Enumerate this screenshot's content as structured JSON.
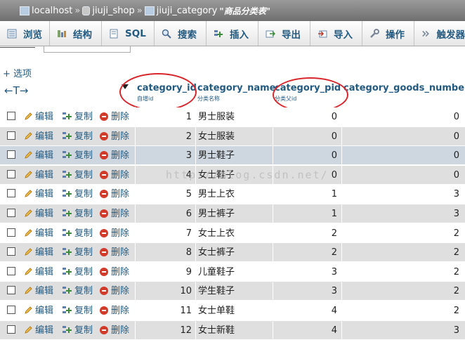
{
  "breadcrumb": {
    "server": "localhost",
    "database": "jiuji_shop",
    "table": "jiuji_category",
    "comment": "\"商品分类表\""
  },
  "tabs": [
    {
      "label": "浏览",
      "icon": "browse-icon"
    },
    {
      "label": "结构",
      "icon": "structure-icon"
    },
    {
      "label": "SQL",
      "icon": "sql-icon"
    },
    {
      "label": "搜索",
      "icon": "search-icon"
    },
    {
      "label": "插入",
      "icon": "insert-icon"
    },
    {
      "label": "导出",
      "icon": "export-icon"
    },
    {
      "label": "导入",
      "icon": "import-icon"
    },
    {
      "label": "操作",
      "icon": "wrench-icon"
    },
    {
      "label": "触发器",
      "icon": "trigger-icon"
    }
  ],
  "options_link": "+ 选项",
  "columns": [
    {
      "name": "category_id",
      "comment": "自增id"
    },
    {
      "name": "category_name",
      "comment": "分类名称"
    },
    {
      "name": "category_pid",
      "comment": "分类父id"
    },
    {
      "name": "category_goods_number",
      "comment": ""
    }
  ],
  "actions": {
    "edit": "编辑",
    "copy": "复制",
    "delete": "删除"
  },
  "rows": [
    {
      "id": "1",
      "name": "男士服装",
      "pid": "0",
      "goods": "0"
    },
    {
      "id": "2",
      "name": "女士服装",
      "pid": "0",
      "goods": "0"
    },
    {
      "id": "3",
      "name": "男士鞋子",
      "pid": "0",
      "goods": "0"
    },
    {
      "id": "4",
      "name": "女士鞋子",
      "pid": "0",
      "goods": "0"
    },
    {
      "id": "5",
      "name": "男士上衣",
      "pid": "1",
      "goods": "3"
    },
    {
      "id": "6",
      "name": "男士裤子",
      "pid": "1",
      "goods": "3"
    },
    {
      "id": "7",
      "name": "女士上衣",
      "pid": "2",
      "goods": "2"
    },
    {
      "id": "8",
      "name": "女士裤子",
      "pid": "2",
      "goods": "2"
    },
    {
      "id": "9",
      "name": "儿童鞋子",
      "pid": "3",
      "goods": "2"
    },
    {
      "id": "10",
      "name": "学生鞋子",
      "pid": "3",
      "goods": "2"
    },
    {
      "id": "11",
      "name": "女士单鞋",
      "pid": "4",
      "goods": "2"
    },
    {
      "id": "12",
      "name": "女士新鞋",
      "pid": "4",
      "goods": "3"
    }
  ],
  "selected_row": 2,
  "watermark": "http://blog.csdn.net/",
  "colors": {
    "link": "#235a81",
    "highlight_ring": "#d8262c",
    "row_alt": "#dfdfdf",
    "row_selected": "#ced6df"
  }
}
